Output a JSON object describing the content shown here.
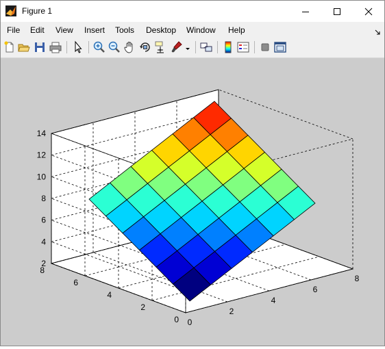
{
  "window": {
    "title": "Figure 1"
  },
  "menu": [
    "File",
    "Edit",
    "View",
    "Insert",
    "Tools",
    "Desktop",
    "Window",
    "Help"
  ],
  "toolbar": {
    "icons": [
      "new-figure-icon",
      "open-file-icon",
      "save-icon",
      "print-icon",
      "select-pointer-icon",
      "zoom-in-icon",
      "zoom-out-icon",
      "pan-hand-icon",
      "rotate-3d-icon",
      "data-cursor-icon",
      "brush-icon",
      "link-plot-icon",
      "colorbar-icon",
      "legend-icon",
      "hide-plot-tools-icon",
      "show-plot-tools-icon"
    ]
  },
  "chart_data": {
    "type": "surface",
    "title": "",
    "xlabel": "",
    "ylabel": "",
    "zlabel": "",
    "x": [
      1,
      2,
      3,
      4,
      5,
      6,
      7
    ],
    "y": [
      1,
      2,
      3,
      4,
      5,
      6,
      7
    ],
    "z_formula": "z = x + y",
    "z": [
      [
        2,
        3,
        4,
        5,
        6,
        7,
        8
      ],
      [
        3,
        4,
        5,
        6,
        7,
        8,
        9
      ],
      [
        4,
        5,
        6,
        7,
        8,
        9,
        10
      ],
      [
        5,
        6,
        7,
        8,
        9,
        10,
        11
      ],
      [
        6,
        7,
        8,
        9,
        10,
        11,
        12
      ],
      [
        7,
        8,
        9,
        10,
        11,
        12,
        13
      ],
      [
        8,
        9,
        10,
        11,
        12,
        13,
        14
      ]
    ],
    "xlim": [
      0,
      8
    ],
    "ylim": [
      0,
      8
    ],
    "zlim": [
      2,
      14
    ],
    "x_ticks": [
      "0",
      "2",
      "4",
      "6",
      "8"
    ],
    "y_ticks": [
      "0",
      "2",
      "4",
      "6",
      "8"
    ],
    "z_ticks": [
      "2",
      "4",
      "6",
      "8",
      "10",
      "12",
      "14"
    ],
    "colormap": "jet",
    "grid": true,
    "box": true,
    "view": {
      "azimuth": -37.5,
      "elevation": 30
    }
  }
}
